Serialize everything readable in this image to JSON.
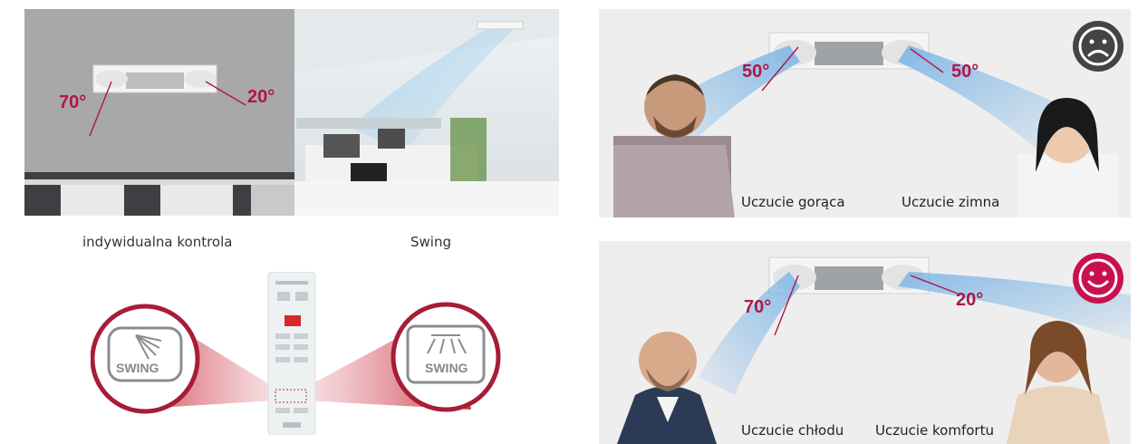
{
  "top_left_panel": {
    "angle_left": "70°",
    "angle_right": "20°",
    "caption_left": "indywidualna kontrola",
    "caption_right": "Swing"
  },
  "remote_panel": {
    "left_button_label": "SWING",
    "right_button_label": "SWING"
  },
  "top_right_panel": {
    "angle_left": "50°",
    "angle_right": "50°",
    "feel_left": "Uczucie gorąca",
    "feel_right": "Uczucie zimna",
    "mood": "sad-face-icon",
    "mood_color": "#444444"
  },
  "bottom_right_panel": {
    "angle_left": "70°",
    "angle_right": "20°",
    "feel_left": "Uczucie chłodu",
    "feel_right": "Uczucie komfortu",
    "mood": "happy-face-icon",
    "mood_color": "#c8104f"
  },
  "colors": {
    "accent": "#b0154a",
    "airflow": "#9cc8ea"
  }
}
